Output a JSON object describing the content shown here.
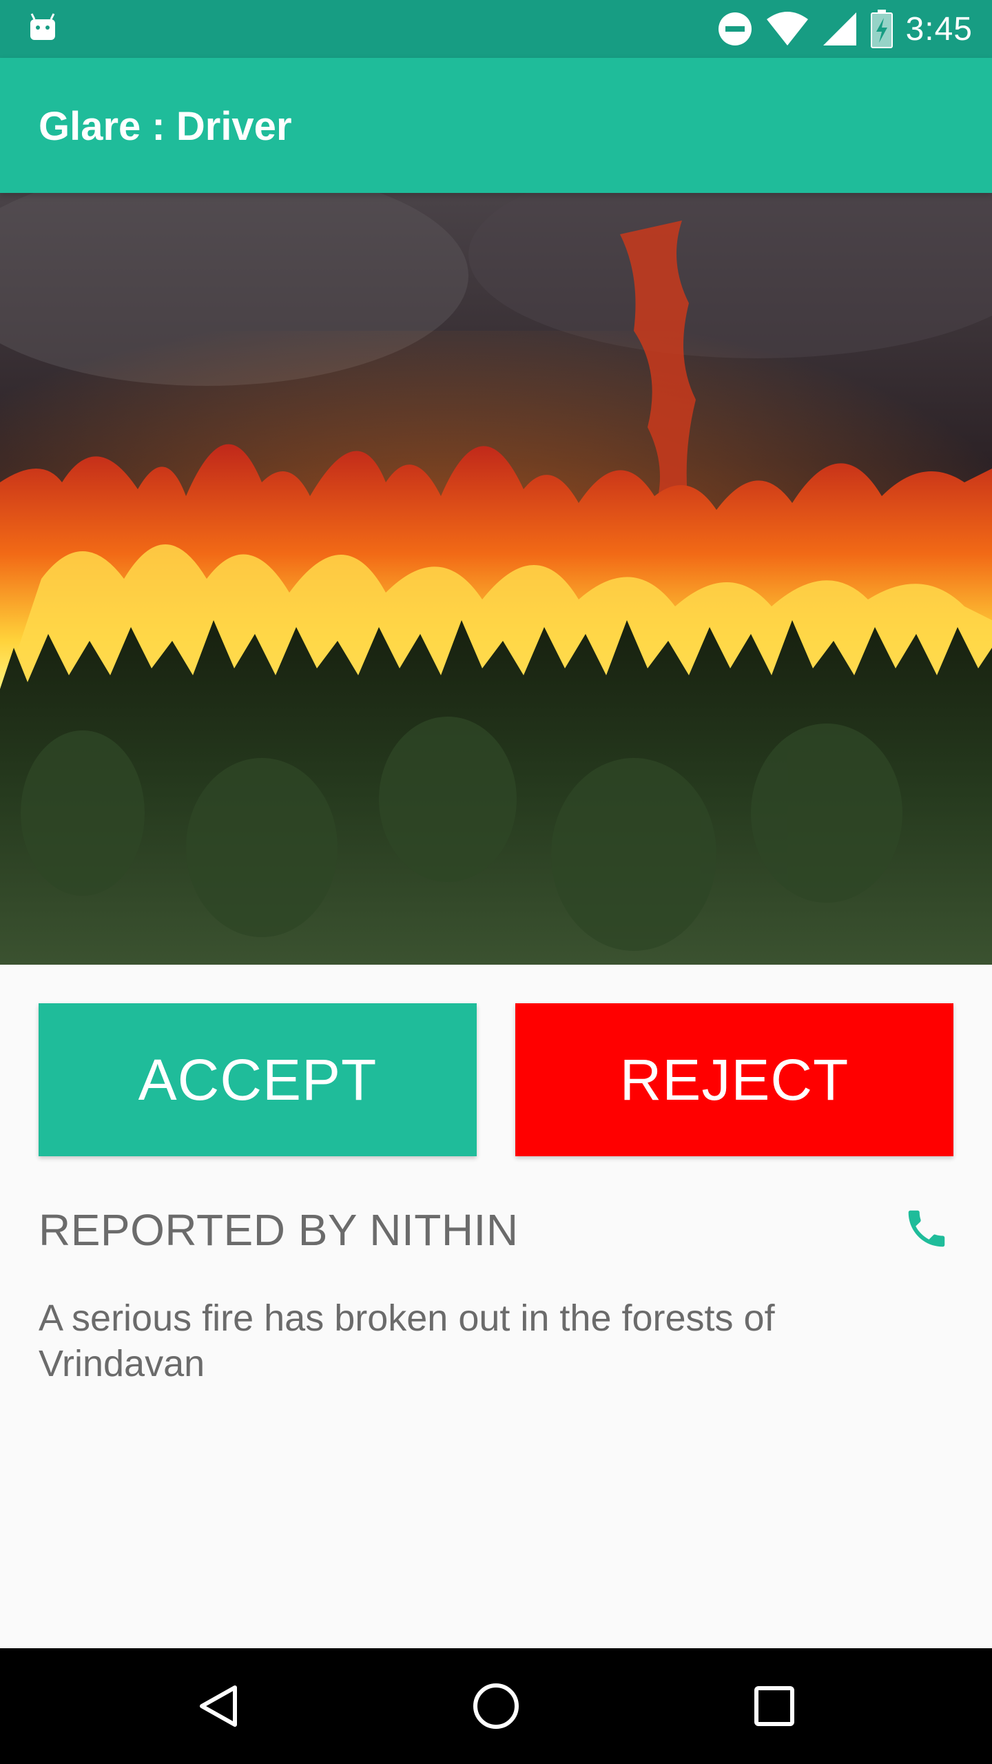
{
  "status_bar": {
    "time": "3:45",
    "icons": [
      "android-debug-icon",
      "do-not-disturb-icon",
      "wifi-icon",
      "cell-signal-icon",
      "battery-charging-icon"
    ]
  },
  "app_bar": {
    "title": "Glare : Driver",
    "color": "#1fbc9a"
  },
  "incident": {
    "image_subject": "forest-fire-photo",
    "accept_label": "ACCEPT",
    "reject_label": "REJECT",
    "accept_color": "#1fbc9a",
    "reject_color": "#ff0000",
    "reported_by": "REPORTED BY NITHIN",
    "call_icon": "phone-icon",
    "description": "A serious fire has broken out in the forests of Vrindavan"
  },
  "nav_bar": {
    "icons": [
      "back-icon",
      "home-icon",
      "recents-icon"
    ]
  }
}
